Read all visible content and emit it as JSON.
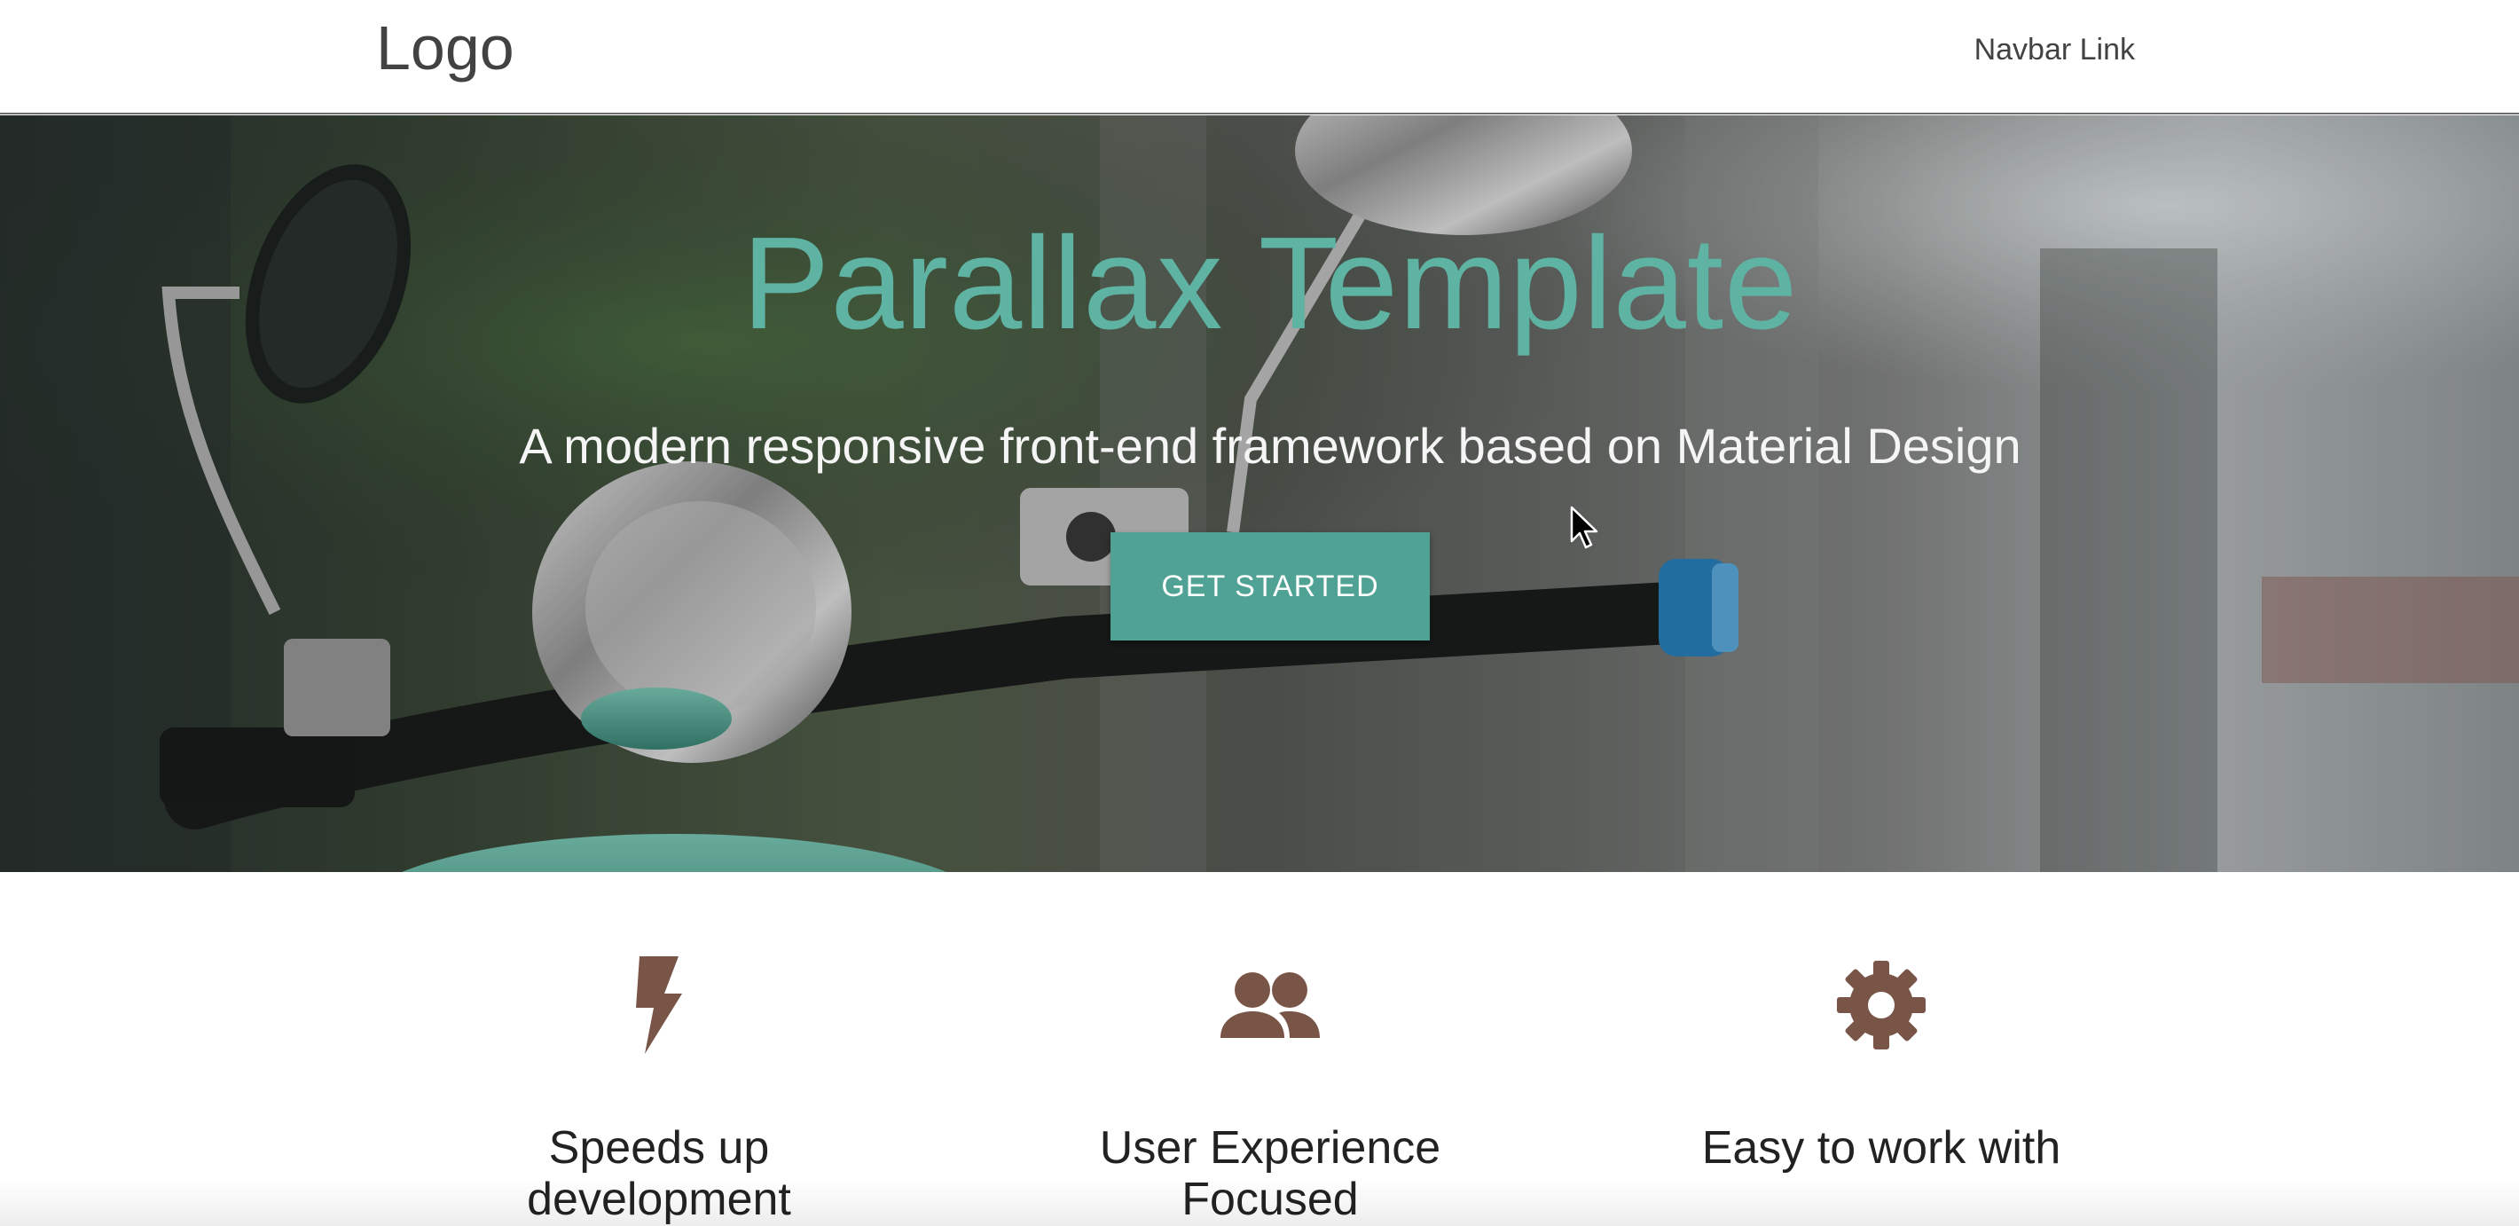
{
  "navbar": {
    "logo": "Logo",
    "link": "Navbar Link"
  },
  "hero": {
    "title": "Parallax Template",
    "subtitle": "A modern responsive front-end framework based on Material Design",
    "cta_label": "GET STARTED",
    "background_image": "scooter-handlebar-photo"
  },
  "features": [
    {
      "icon": "flash-icon",
      "title": "Speeds up development"
    },
    {
      "icon": "people-icon",
      "title": "User Experience Focused"
    },
    {
      "icon": "gear-icon",
      "title": "Easy to work with"
    }
  ],
  "colors": {
    "accent": "#50a294",
    "title": "#5fb3a3",
    "icon": "#795548",
    "text": "#222222"
  }
}
